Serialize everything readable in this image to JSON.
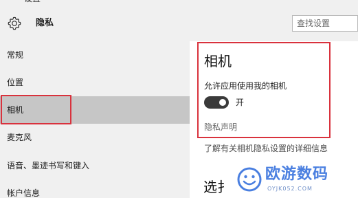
{
  "window": {
    "back_glyph": "←",
    "title": "设置"
  },
  "header": {
    "title": "隐私",
    "icon": "gear-icon"
  },
  "search": {
    "placeholder": "查找设置",
    "value": ""
  },
  "sidebar": {
    "items": [
      {
        "label": "常规"
      },
      {
        "label": "位置"
      },
      {
        "label": "相机",
        "selected": true
      },
      {
        "label": "麦克风"
      },
      {
        "label": "语音、墨迹书写和键入"
      },
      {
        "label": "帐户信息"
      }
    ]
  },
  "camera": {
    "heading": "相机",
    "allow_label": "允许应用使用我的相机",
    "toggle_on": true,
    "toggle_state_label": "开",
    "privacy_link": "隐私声明",
    "learn_more_link": "了解有关相机隐私设置的详细信息",
    "next_heading": "选扌"
  },
  "watermark": {
    "name": "欧游数码",
    "url": "OYJK052.COM"
  },
  "colors": {
    "highlight_border": "#d9323d",
    "selected_bg": "#c6c6c6",
    "sidebar_bg": "#f0f0f0",
    "toggle_on": "#3a3a3a",
    "watermark": "#4a7fe0"
  }
}
